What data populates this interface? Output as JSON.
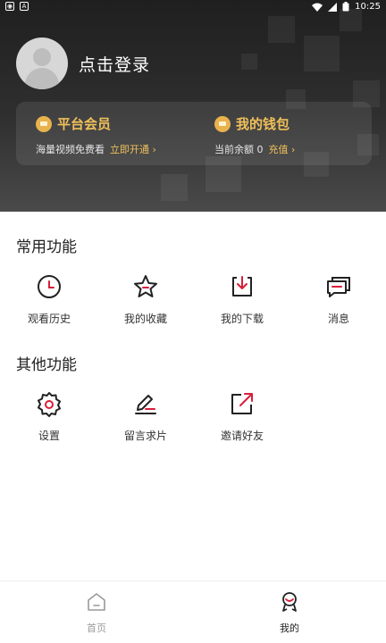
{
  "status_bar": {
    "time": "10:25",
    "left_icons": [
      "notification-icon",
      "app-icon"
    ],
    "right_icons": [
      "wifi-icon",
      "signal-icon",
      "battery-icon"
    ]
  },
  "header": {
    "login_text": "点击登录",
    "member_card": {
      "title": "平台会员",
      "subtitle": "海量视频免费看",
      "action": "立即开通 ›"
    },
    "wallet_card": {
      "title": "我的钱包",
      "subtitle": "当前余额 0",
      "action": "充值 ›"
    }
  },
  "common_section": {
    "title": "常用功能",
    "items": [
      {
        "label": "观看历史",
        "icon": "history-clock-icon"
      },
      {
        "label": "我的收藏",
        "icon": "star-icon"
      },
      {
        "label": "我的下载",
        "icon": "download-icon"
      },
      {
        "label": "消息",
        "icon": "message-icon"
      }
    ]
  },
  "other_section": {
    "title": "其他功能",
    "items": [
      {
        "label": "设置",
        "icon": "settings-gear-icon"
      },
      {
        "label": "留言求片",
        "icon": "edit-pen-icon"
      },
      {
        "label": "邀请好友",
        "icon": "share-icon"
      }
    ]
  },
  "bottom_nav": {
    "items": [
      {
        "label": "首页",
        "icon": "home-icon"
      },
      {
        "label": "我的",
        "icon": "profile-badge-icon"
      }
    ],
    "colors": {
      "active": "#222222",
      "inactive": "#9a9a9a"
    }
  },
  "colors": {
    "accent": "#d81e3a",
    "gold": "#f0c05a"
  }
}
